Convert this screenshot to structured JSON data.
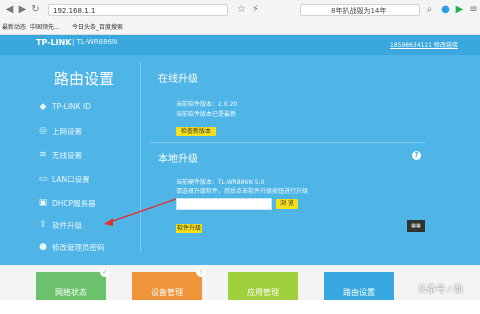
{
  "browser": {
    "address": "192.168.1.1",
    "search_text": "8年扒战毁为14年",
    "bookmarks": [
      "最新动态",
      "中国领先...",
      "今日头条_百度搜索"
    ]
  },
  "router": {
    "brand": "TP-LINK",
    "model": "| TL-WR886N",
    "header_link": "18598634121 修改链接",
    "sidebar_title": "路由设置",
    "nav": [
      {
        "label": "TP-LINK ID",
        "icon": "id-icon"
      },
      {
        "label": "上网设置",
        "icon": "globe-icon"
      },
      {
        "label": "无线设置",
        "icon": "wifi-icon"
      },
      {
        "label": "LAN口设置",
        "icon": "lan-icon"
      },
      {
        "label": "DHCP服务器",
        "icon": "dhcp-icon"
      },
      {
        "label": "软件升级",
        "icon": "upload-icon"
      },
      {
        "label": "修改管理员密码",
        "icon": "user-icon"
      }
    ],
    "online": {
      "title": "在线升级",
      "version_line": "当前软件版本：2.0.20",
      "status_line": "当前软件版本已是最新",
      "button": "检查新版本"
    },
    "local": {
      "title": "本地升级",
      "version_line": "当前硬件版本：TL-WR886N 5.0",
      "hint": "请选择升级软件，然后点击软件升级按钮进行升级",
      "browse_button": "浏 览",
      "upgrade_button": "软件升级",
      "help": "?"
    },
    "tiles": [
      {
        "label": "网络状态",
        "color": "#6cc26c",
        "badge": "✓"
      },
      {
        "label": "设备管理",
        "color": "#f0943a",
        "badge": "!"
      },
      {
        "label": "应用管理",
        "color": "#9fcf3b",
        "badge": ""
      },
      {
        "label": "路由设置",
        "color": "#38a9e0",
        "badge": ""
      }
    ],
    "watermark": "头条号 / 鼎"
  }
}
